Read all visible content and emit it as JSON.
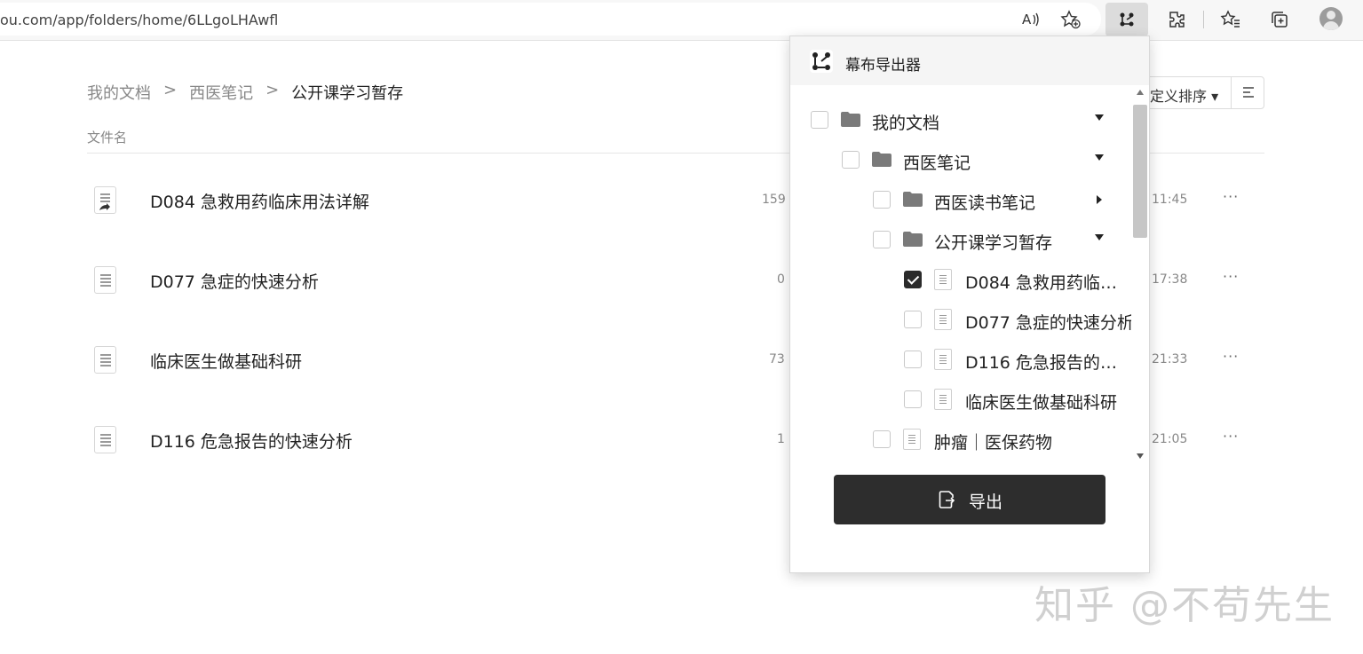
{
  "browser": {
    "url": "ou.com/app/folders/home/6LLgoLHAwfl"
  },
  "breadcrumb": {
    "items": [
      "我的文档",
      "西医笔记"
    ],
    "current": "公开课学习暂存",
    "separator": ">"
  },
  "list": {
    "column_name": "文件名",
    "sort_label": "定义排序 ▾",
    "files": [
      {
        "name": "D084 急救用药临床用法详解",
        "count": "159 :",
        "time": "11:45",
        "more": "···"
      },
      {
        "name": "D077 急症的快速分析",
        "count": "0 :",
        "time": "17:38",
        "more": "···"
      },
      {
        "name": "临床医生做基础科研",
        "count": "73 :",
        "time": "21:33",
        "more": "···"
      },
      {
        "name": "D116 危急报告的快速分析",
        "count": "1 :",
        "time": "21:05",
        "more": "···"
      }
    ]
  },
  "popup": {
    "title": "幕布导出器",
    "tree": [
      {
        "label": "我的文档",
        "type": "folder",
        "checked": false,
        "caret": "down"
      },
      {
        "label": "西医笔记",
        "type": "folder",
        "checked": false,
        "caret": "down"
      },
      {
        "label": "西医读书笔记",
        "type": "folder",
        "checked": false,
        "caret": "right"
      },
      {
        "label": "公开课学习暂存",
        "type": "folder",
        "checked": false,
        "caret": "down"
      },
      {
        "label": "D084 急救用药临床用法详解",
        "type": "doc",
        "checked": true
      },
      {
        "label": "D077 急症的快速分析",
        "type": "doc",
        "checked": false
      },
      {
        "label": "D116 危急报告的快速分析",
        "type": "doc",
        "checked": false
      },
      {
        "label": "临床医生做基础科研",
        "type": "doc",
        "checked": false
      },
      {
        "label": "肿瘤｜医保药物",
        "type": "doc",
        "checked": false
      }
    ],
    "export_label": "导出"
  },
  "watermark": "知乎 @不苟先生",
  "colors": {
    "accent_dark": "#2d2d2d",
    "folder": "#7a7a7a"
  }
}
